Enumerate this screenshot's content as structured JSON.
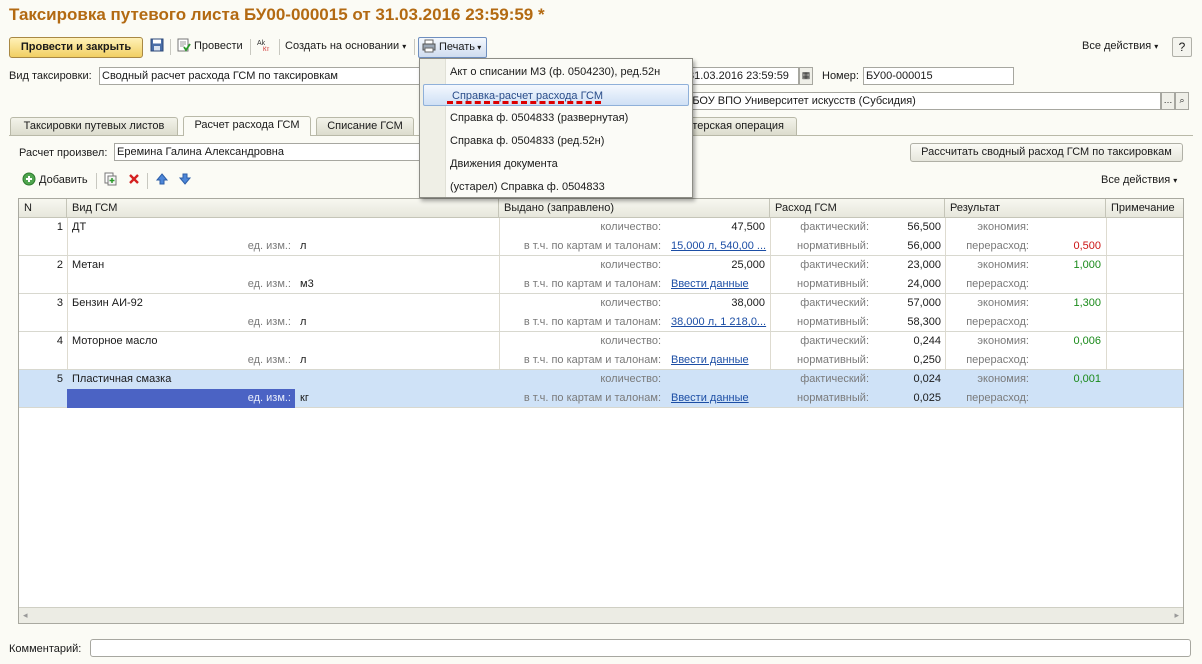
{
  "window": {
    "title": "Таксировка путевого листа БУ00-000015 от 31.03.2016 23:59:59 *"
  },
  "toolbar": {
    "post_close": "Провести и закрыть",
    "post": "Провести",
    "create_based": "Создать на основании",
    "print": "Печать",
    "all_actions": "Все действия",
    "help": "?"
  },
  "fields": {
    "tax_type_label": "Вид таксировки:",
    "tax_type_value": "Сводный расчет расхода ГСМ по таксировкам",
    "date_value": "31.03.2016 23:59:59",
    "number_label": "Номер:",
    "number_value": "БУ00-000015",
    "institution_value": "ФГБОУ ВПО Университет искусств (Субсидия)"
  },
  "tabs": [
    {
      "label": "Таксировки путевых листов"
    },
    {
      "label": "Расчет расхода ГСМ"
    },
    {
      "label": "Списание ГСМ"
    },
    {
      "label": "Бухгалтерская операция"
    }
  ],
  "calc": {
    "produced_by_label": "Расчет произвел:",
    "produced_by_value": "Еремина Галина Александровна",
    "recalc_button": "Рассчитать сводный расход ГСМ по таксировкам"
  },
  "grid_toolbar": {
    "add": "Добавить",
    "all_actions": "Все действия"
  },
  "grid": {
    "headers": [
      "N",
      "Вид ГСМ",
      "Выдано (заправлено)",
      "Расход ГСМ",
      "Результат",
      "Примечание"
    ],
    "unit_label": "ед. изм.:",
    "qty_label": "количество:",
    "cards_label": "в т.ч. по картам и талонам:",
    "actual_label": "фактический:",
    "norm_label": "нормативный:",
    "saving_label": "экономия:",
    "overrun_label": "перерасход:",
    "rows": [
      {
        "n": "1",
        "fuel": "ДТ",
        "unit": "л",
        "qty": "47,500",
        "cards": "15,000 л, 540,00 ...",
        "actual": "56,500",
        "norm": "56,000",
        "saving": "",
        "overrun": "0,500"
      },
      {
        "n": "2",
        "fuel": "Метан",
        "unit": "м3",
        "qty": "25,000",
        "cards": "Ввести данные",
        "actual": "23,000",
        "norm": "24,000",
        "saving": "1,000",
        "overrun": ""
      },
      {
        "n": "3",
        "fuel": "Бензин АИ-92",
        "unit": "л",
        "qty": "38,000",
        "cards": "38,000 л, 1 218,0...",
        "actual": "57,000",
        "norm": "58,300",
        "saving": "1,300",
        "overrun": ""
      },
      {
        "n": "4",
        "fuel": "Моторное масло",
        "unit": "л",
        "qty": "",
        "cards": "Ввести данные",
        "actual": "0,244",
        "norm": "0,250",
        "saving": "0,006",
        "overrun": ""
      },
      {
        "n": "5",
        "fuel": "Пластичная смазка",
        "unit": "кг",
        "qty": "",
        "cards": "Ввести данные",
        "actual": "0,024",
        "norm": "0,025",
        "saving": "0,001",
        "overrun": ""
      }
    ]
  },
  "comment": {
    "label": "Комментарий:",
    "value": ""
  },
  "print_menu": {
    "items": [
      "Акт о списании МЗ (ф. 0504230), ред.52н",
      "Справка-расчет расхода ГСМ",
      "Справка ф. 0504833 (развернутая)",
      "Справка ф. 0504833 (ред.52н)",
      "Движения документа",
      "(устарел) Справка ф. 0504833"
    ],
    "highlighted_index": 1
  },
  "colors": {
    "title": "#b36a12",
    "highlight_dash": "#dd0000",
    "selected_row": "#cfe2f7",
    "link": "#1c4ea5"
  }
}
